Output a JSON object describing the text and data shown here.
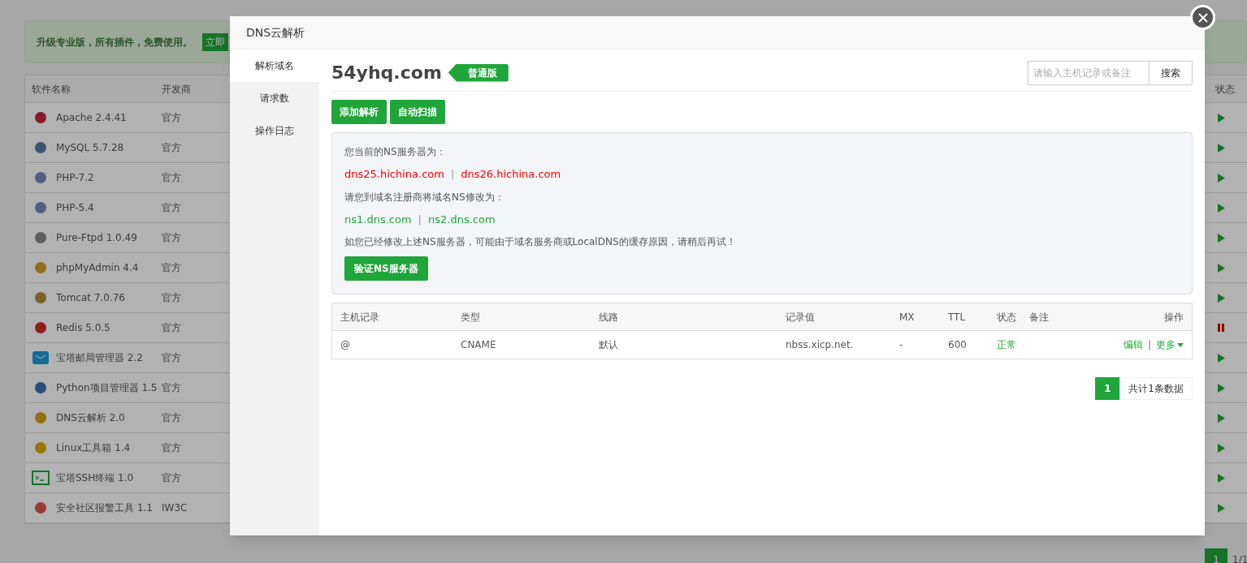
{
  "background": {
    "banner": {
      "text": "升级专业版，所有插件，免费使用。",
      "button": "立即"
    },
    "table": {
      "columns": [
        "软件名称",
        "开发商",
        "状态"
      ],
      "rows": [
        {
          "name": "Apache 2.4.41",
          "developer": "官方",
          "running": true
        },
        {
          "name": "MySQL 5.7.28",
          "developer": "官方",
          "running": true
        },
        {
          "name": "PHP-7.2",
          "developer": "官方",
          "running": true
        },
        {
          "name": "PHP-5.4",
          "developer": "官方",
          "running": true
        },
        {
          "name": "Pure-Ftpd 1.0.49",
          "developer": "官方",
          "running": true
        },
        {
          "name": "phpMyAdmin 4.4",
          "developer": "官方",
          "running": true
        },
        {
          "name": "Tomcat 7.0.76",
          "developer": "官方",
          "running": true
        },
        {
          "name": "Redis 5.0.5",
          "developer": "官方",
          "running": false
        },
        {
          "name": "宝塔邮局管理器 2.2",
          "developer": "官方",
          "running": true
        },
        {
          "name": "Python项目管理器 1.5",
          "developer": "官方",
          "running": true
        },
        {
          "name": "DNS云解析 2.0",
          "developer": "官方",
          "running": true
        },
        {
          "name": "Linux工具箱 1.4",
          "developer": "官方",
          "running": true
        },
        {
          "name": "宝塔SSH终端 1.0",
          "developer": "官方",
          "running": true
        },
        {
          "name": "安全社区报警工具 1.1",
          "developer": "IW3C",
          "running": true
        }
      ]
    },
    "pager": {
      "page": "1",
      "info": "1/1"
    }
  },
  "dialog": {
    "title": "DNS云解析",
    "sidebar": [
      {
        "label": "解析域名",
        "selected": true
      },
      {
        "label": "请求数",
        "selected": false
      },
      {
        "label": "操作日志",
        "selected": false
      }
    ],
    "domain": "54yhq.com",
    "tag": "普通版",
    "search": {
      "placeholder": "请输入主机记录或备注",
      "button": "搜索"
    },
    "actions": [
      "添加解析",
      "自动扫描"
    ],
    "ns": {
      "separator": "|",
      "current_label": "您当前的NS服务器为：",
      "current": [
        "dns25.hichina.com",
        "dns26.hichina.com"
      ],
      "target_label": "请您到域名注册商将域名NS修改为：",
      "target": [
        "ns1.dns.com",
        "ns2.dns.com"
      ],
      "note": "如您已经修改上述NS服务器，可能由于域名服务商或LocalDNS的缓存原因，请稍后再试！",
      "button": "验证NS服务器"
    },
    "records": {
      "columns": [
        "主机记录",
        "类型",
        "线路",
        "记录值",
        "MX",
        "TTL",
        "状态",
        "备注",
        "操作"
      ],
      "rows": [
        {
          "host": "@",
          "type": "CNAME",
          "line": "默认",
          "value": "nbss.xicp.net.",
          "mx": "-",
          "ttl": "600",
          "status": "正常",
          "edit": "编辑",
          "separator": "|",
          "more": "更多"
        }
      ]
    },
    "pager": {
      "page": "1",
      "info": "共计1条数据"
    }
  }
}
